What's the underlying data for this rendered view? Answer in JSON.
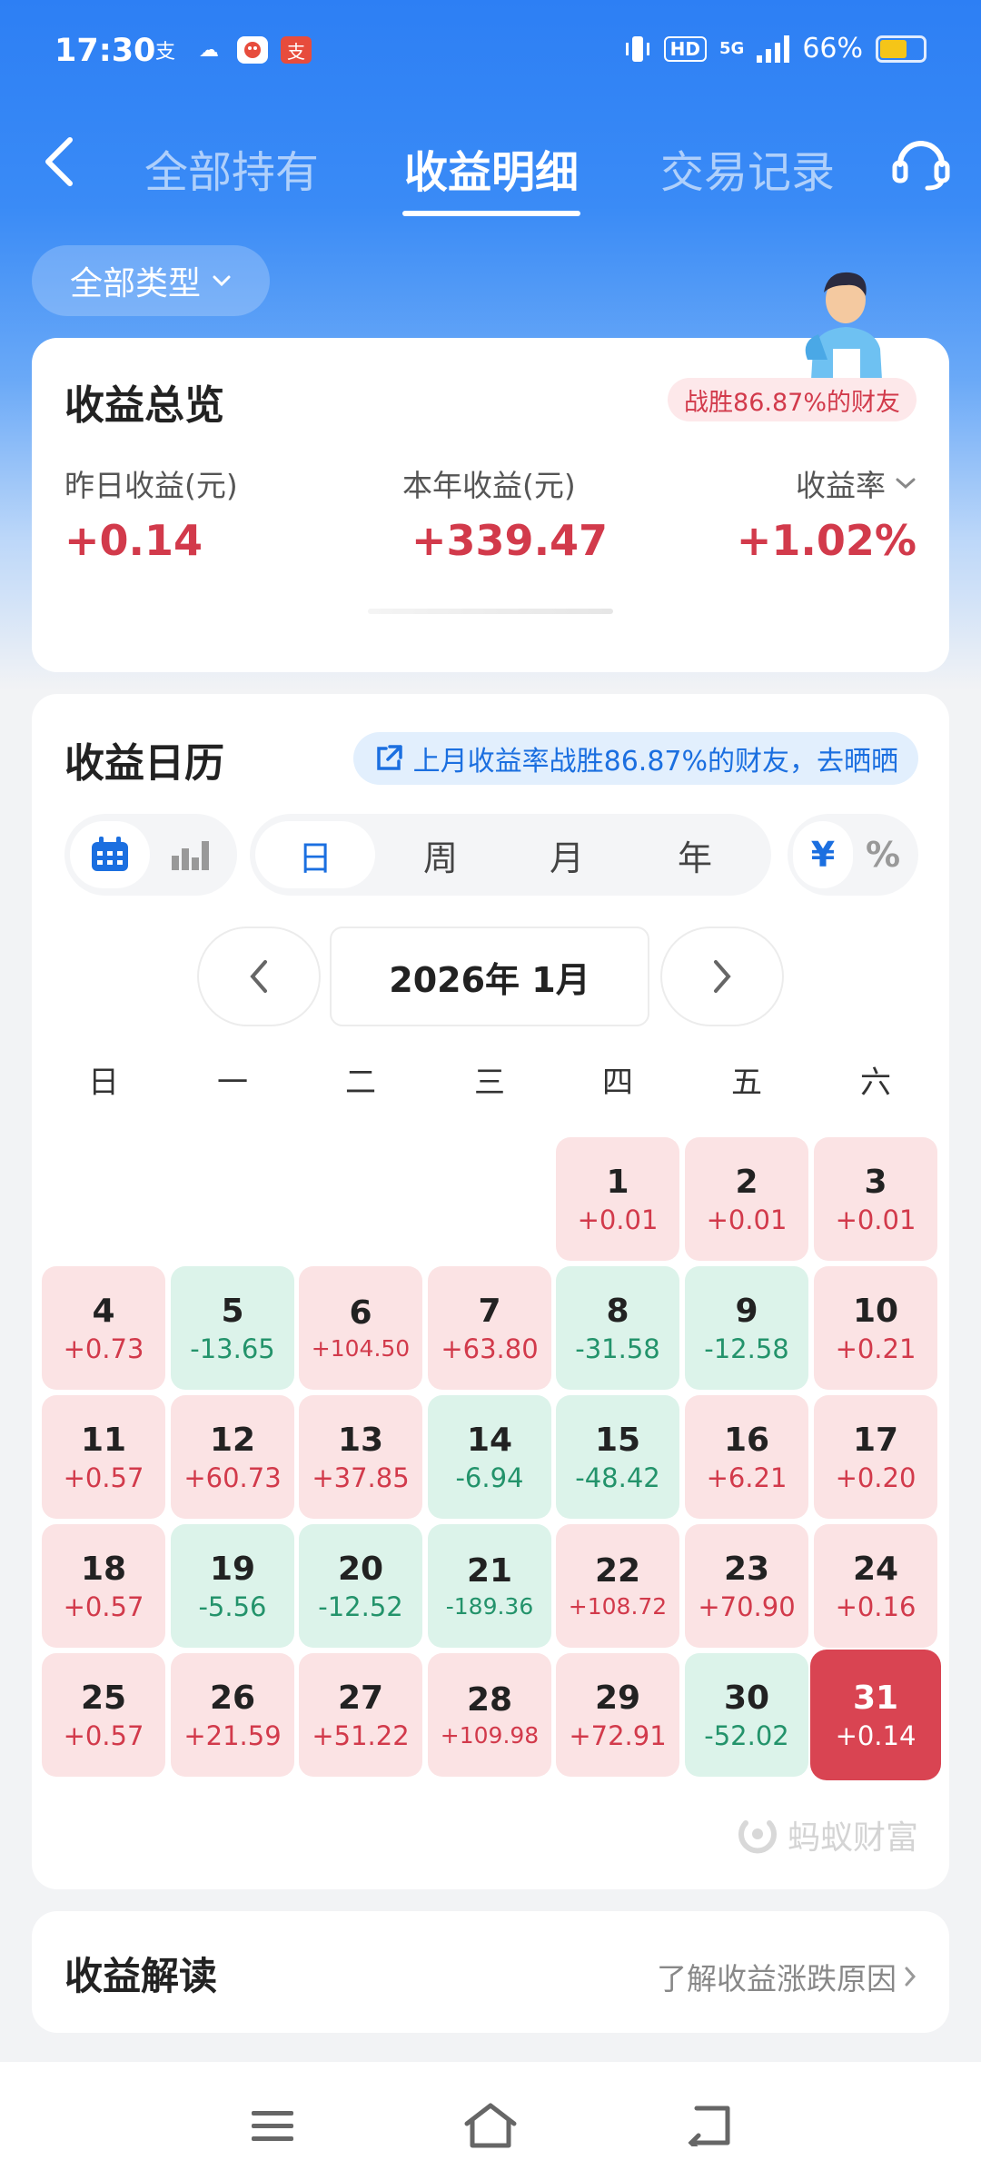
{
  "status_bar": {
    "time": "17:30",
    "apps": [
      {
        "icon": "alipay-icon",
        "glyph": "支",
        "color": "#ffffff"
      },
      {
        "icon": "cloud-app-icon",
        "glyph": "☁",
        "color": "#ffffff"
      },
      {
        "icon": "pig-app-icon",
        "glyph": "●",
        "color": "#e74c3c"
      },
      {
        "icon": "alipay-red-icon",
        "glyph": "支",
        "color": "#e74c3c"
      }
    ],
    "network": "5G",
    "hd": "HD",
    "battery": "66%",
    "battery_level": 0.66
  },
  "nav": {
    "tabs": [
      {
        "label": "全部持有",
        "active": false
      },
      {
        "label": "收益明细",
        "active": true
      },
      {
        "label": "交易记录",
        "active": false
      }
    ]
  },
  "filter": {
    "label": "全部类型"
  },
  "overview": {
    "title": "收益总览",
    "badge": "战胜86.87%的财友",
    "yesterday_label": "昨日收益(元)",
    "yesterday_value": "+0.14",
    "year_label": "本年收益(元)",
    "year_value": "+339.47",
    "rate_label": "收益率",
    "rate_value": "+1.02%"
  },
  "calendar": {
    "title": "收益日历",
    "share_text": "上月收益率战胜86.87%的财友，去晒晒",
    "periods": [
      "日",
      "周",
      "月",
      "年"
    ],
    "active_period": "日",
    "unit_options": [
      "¥",
      "%"
    ],
    "active_unit": "¥",
    "month_label": "2026年 1月",
    "weekdays": [
      "日",
      "一",
      "二",
      "三",
      "四",
      "五",
      "六"
    ],
    "days": [
      {
        "d": "1",
        "v": "+0.01",
        "s": "pos"
      },
      {
        "d": "2",
        "v": "+0.01",
        "s": "pos"
      },
      {
        "d": "3",
        "v": "+0.01",
        "s": "pos"
      },
      {
        "d": "4",
        "v": "+0.73",
        "s": "pos"
      },
      {
        "d": "5",
        "v": "-13.65",
        "s": "neg"
      },
      {
        "d": "6",
        "v": "+104.50",
        "s": "pos"
      },
      {
        "d": "7",
        "v": "+63.80",
        "s": "pos"
      },
      {
        "d": "8",
        "v": "-31.58",
        "s": "neg"
      },
      {
        "d": "9",
        "v": "-12.58",
        "s": "neg"
      },
      {
        "d": "10",
        "v": "+0.21",
        "s": "pos"
      },
      {
        "d": "11",
        "v": "+0.57",
        "s": "pos"
      },
      {
        "d": "12",
        "v": "+60.73",
        "s": "pos"
      },
      {
        "d": "13",
        "v": "+37.85",
        "s": "pos"
      },
      {
        "d": "14",
        "v": "-6.94",
        "s": "neg"
      },
      {
        "d": "15",
        "v": "-48.42",
        "s": "neg"
      },
      {
        "d": "16",
        "v": "+6.21",
        "s": "pos"
      },
      {
        "d": "17",
        "v": "+0.20",
        "s": "pos"
      },
      {
        "d": "18",
        "v": "+0.57",
        "s": "pos"
      },
      {
        "d": "19",
        "v": "-5.56",
        "s": "neg"
      },
      {
        "d": "20",
        "v": "-12.52",
        "s": "neg"
      },
      {
        "d": "21",
        "v": "-189.36",
        "s": "neg"
      },
      {
        "d": "22",
        "v": "+108.72",
        "s": "pos"
      },
      {
        "d": "23",
        "v": "+70.90",
        "s": "pos"
      },
      {
        "d": "24",
        "v": "+0.16",
        "s": "pos"
      },
      {
        "d": "25",
        "v": "+0.57",
        "s": "pos"
      },
      {
        "d": "26",
        "v": "+21.59",
        "s": "pos"
      },
      {
        "d": "27",
        "v": "+51.22",
        "s": "pos"
      },
      {
        "d": "28",
        "v": "+109.98",
        "s": "pos"
      },
      {
        "d": "29",
        "v": "+72.91",
        "s": "pos"
      },
      {
        "d": "30",
        "v": "-52.02",
        "s": "neg"
      },
      {
        "d": "31",
        "v": "+0.14",
        "s": "today"
      }
    ],
    "watermark": "蚂蚁财富"
  },
  "interpretation": {
    "title": "收益解读",
    "link": "了解收益涨跌原因"
  },
  "colors": {
    "primary_blue": "#2d7ff4",
    "gain_red": "#d23a4b",
    "loss_green": "#23936b",
    "gain_bg": "#fbe3e4",
    "loss_bg": "#dcf3ea"
  }
}
